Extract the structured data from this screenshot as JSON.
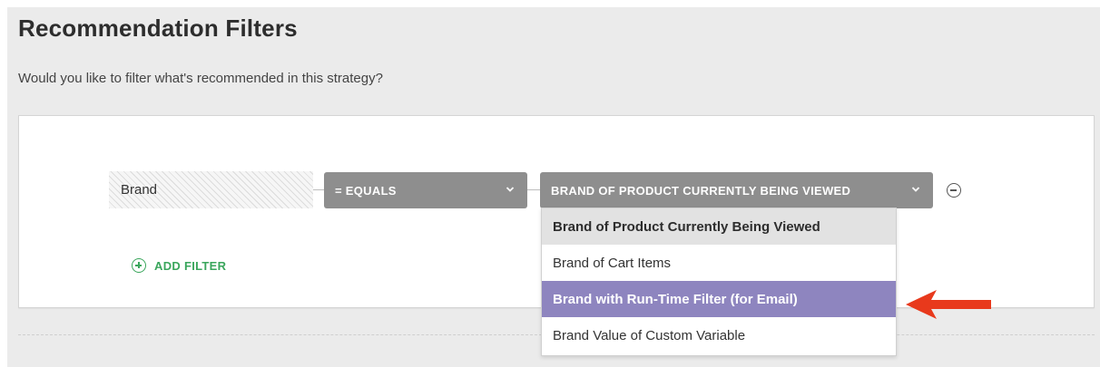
{
  "section": {
    "title": "Recommendation Filters",
    "subtitle": "Would you like to filter what's recommended in this strategy?"
  },
  "filter": {
    "field_label": "Brand",
    "operator_label": "= EQUALS",
    "value_label": "BRAND OF PRODUCT CURRENTLY BEING VIEWED"
  },
  "add_filter": {
    "label": "ADD FILTER",
    "icon": "plus-circle-icon"
  },
  "dropdown": {
    "options": [
      "Brand of Product Currently Being Viewed",
      "Brand of Cart Items",
      "Brand with Run-Time Filter (for Email)",
      "Brand Value of Custom Variable"
    ],
    "selected_index": 0,
    "highlighted_index": 2
  },
  "colors": {
    "select_bg": "#8e8e8e",
    "add_green": "#3aa65c",
    "highlight": "#8e85bf",
    "arrow": "#e8391c"
  }
}
